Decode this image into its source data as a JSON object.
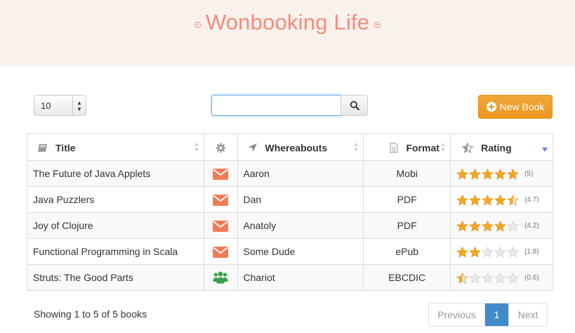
{
  "header": {
    "title": "Wonbooking Life"
  },
  "controls": {
    "page_size": "10",
    "search_value": "",
    "search_placeholder": "",
    "new_book_label": "New Book"
  },
  "table": {
    "columns": {
      "title": "Title",
      "whereabouts": "Whereabouts",
      "format": "Format",
      "rating": "Rating"
    },
    "rows": [
      {
        "title": "The Future of Java Applets",
        "action": "envelope-icon",
        "whereabouts": "Aaron",
        "format": "Mobi",
        "rating": 5,
        "rating_text": "(5)"
      },
      {
        "title": "Java Puzzlers",
        "action": "envelope-icon",
        "whereabouts": "Dan",
        "format": "PDF",
        "rating": 4.7,
        "rating_text": "(4.7)"
      },
      {
        "title": "Joy of Clojure",
        "action": "envelope-icon",
        "whereabouts": "Anatoly",
        "format": "PDF",
        "rating": 4.2,
        "rating_text": "(4.2)"
      },
      {
        "title": "Functional Programming in Scala",
        "action": "envelope-icon",
        "whereabouts": "Some Dude",
        "format": "ePub",
        "rating": 1.8,
        "rating_text": "(1.8)"
      },
      {
        "title": "Struts: The Good Parts",
        "action": "users-icon",
        "whereabouts": "Chariot",
        "format": "EBCDIC",
        "rating": 0.6,
        "rating_text": "(0.6)"
      }
    ]
  },
  "footer": {
    "showing": "Showing 1 to 5 of 5 books",
    "prev": "Previous",
    "page": "1",
    "next": "Next"
  },
  "colors": {
    "brand": "#f48b7a",
    "header_bg": "#f9f1ec",
    "accent_orange": "#ec971f",
    "envelope": "#f07c54",
    "users": "#3aa047",
    "star": "#f5a623",
    "page_active": "#428bca"
  }
}
